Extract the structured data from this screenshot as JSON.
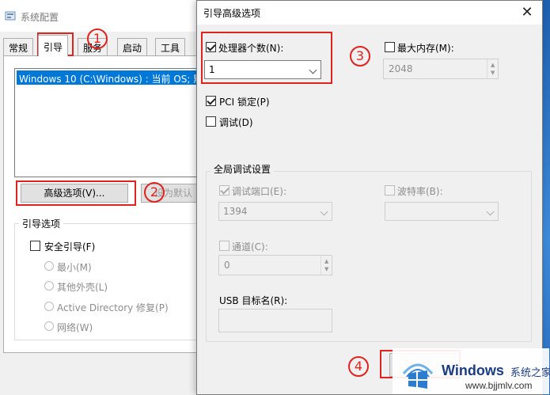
{
  "msconfig": {
    "title": "系统配置",
    "tabs": [
      {
        "label": "常规"
      },
      {
        "label": "引导"
      },
      {
        "label": "服务"
      },
      {
        "label": "启动"
      },
      {
        "label": "工具"
      }
    ],
    "os_entry": "Windows 10 (C:\\Windows) : 当前 OS; 默",
    "advanced_button": "高级选项(V)...",
    "default_button": "设为默认",
    "boot_options_label": "引导选项",
    "safe_boot_label": "安全引导(F)",
    "radio_minimal": "最小(M)",
    "radio_alt_shell": "其他外壳(L)",
    "radio_ad_repair": "Active Directory 修复(P)",
    "radio_network": "网络(W)"
  },
  "dialog": {
    "title": "引导高级选项",
    "close_glyph": "✕",
    "num_processors_label": "处理器个数(N):",
    "num_processors_value": "1",
    "max_memory_label": "最大内存(M):",
    "max_memory_value": "2048",
    "pci_lock_label": "PCI 锁定(P)",
    "debug_label": "调试(D)",
    "global_debug_label": "全局调试设置",
    "debug_port_label": "调试端口(E):",
    "debug_port_value": "1394",
    "baud_rate_label": "波特率(B):",
    "channel_label": "通道(C):",
    "channel_value": "0",
    "usb_target_label": "USB 目标名(R):"
  },
  "annotations": [
    "1",
    "2",
    "3",
    "4"
  ],
  "watermark": {
    "brand": "Windows",
    "brand_suffix": "系统之家",
    "url": "www.bjjmlv.com"
  }
}
